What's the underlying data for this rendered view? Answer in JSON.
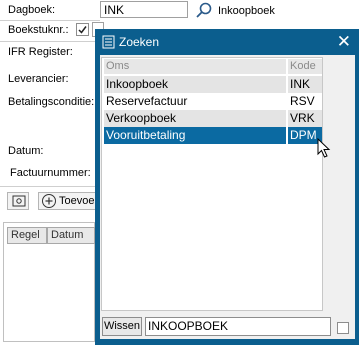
{
  "form": {
    "dagboek_label": "Dagboek:",
    "dagboek_value": "INK",
    "dagboek_name": "Inkoopboek",
    "boekstuknr_label": "Boekstuknr.:",
    "ifr_label": "IFR Register:",
    "leverancier_label": "Leverancier:",
    "betalingsconditie_label": "Betalingsconditie:",
    "datum_label": "Datum:",
    "factuurnummer_label": "Factuurnummer:",
    "toevoegen_label": "Toevoe",
    "grid_headers": [
      "Regel",
      "Datum"
    ]
  },
  "dialog": {
    "title": "Zoeken",
    "columns": [
      "Oms",
      "Kode"
    ],
    "rows": [
      {
        "oms": "Inkoopboek",
        "kode": "INK"
      },
      {
        "oms": "Reservefactuur",
        "kode": "RSV"
      },
      {
        "oms": "Verkoopboek",
        "kode": "VRK"
      },
      {
        "oms": "Vooruitbetaling",
        "kode": "DPM"
      }
    ],
    "selected_index": 3,
    "wissen_label": "Wissen",
    "search_value": "INKOOPBOEK"
  },
  "colors": {
    "dialog_frame": "#0b5e8e",
    "selection": "#0b6aa2",
    "alt_row": "#e4e4e4"
  }
}
